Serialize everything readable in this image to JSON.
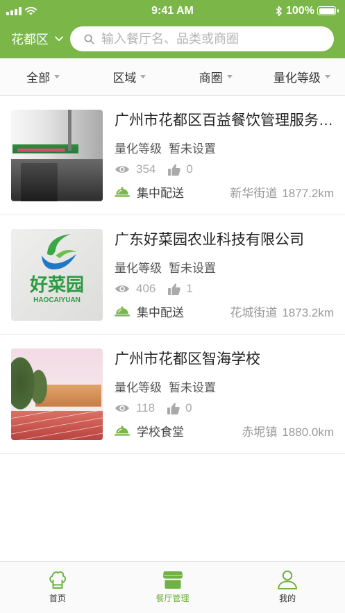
{
  "status_bar": {
    "time": "9:41 AM",
    "battery_percent": "100%",
    "icons": [
      "signal-icon",
      "wifi-icon",
      "bluetooth-icon",
      "battery-icon"
    ]
  },
  "header": {
    "city": "花都区",
    "city_icon": "chevron-down-icon",
    "search_placeholder": "输入餐厅名、品类或商圈",
    "search_icon": "search-icon"
  },
  "filters": [
    {
      "label": "全部",
      "icon": "triangle-down-icon"
    },
    {
      "label": "区域",
      "icon": "triangle-down-icon"
    },
    {
      "label": "商圈",
      "icon": "triangle-down-icon"
    },
    {
      "label": "量化等级",
      "icon": "triangle-down-icon"
    }
  ],
  "list_icons": {
    "views": "eye-icon",
    "likes": "thumbs-up-icon",
    "category": "cloche-icon"
  },
  "restaurants": [
    {
      "name": "广州市花都区百益餐饮管理服务…",
      "grade_label": "量化等级",
      "grade_value": "暂未设置",
      "views": "354",
      "likes": "0",
      "category": "集中配送",
      "street": "新华街道",
      "distance": "1877.2km"
    },
    {
      "name": "广东好菜园农业科技有限公司",
      "grade_label": "量化等级",
      "grade_value": "暂未设置",
      "views": "406",
      "likes": "1",
      "category": "集中配送",
      "street": "花城街道",
      "distance": "1873.2km",
      "logo_text": "好菜园",
      "logo_subtext": "HAOCAIYUAN"
    },
    {
      "name": "广州市花都区智海学校",
      "grade_label": "量化等级",
      "grade_value": "暂未设置",
      "views": "118",
      "likes": "0",
      "category": "学校食堂",
      "street": "赤坭镇",
      "distance": "1880.0km"
    }
  ],
  "tabs": [
    {
      "label": "首页",
      "icon": "chef-hat-icon",
      "active": false
    },
    {
      "label": "餐厅管理",
      "icon": "storefront-icon",
      "active": true
    },
    {
      "label": "我的",
      "icon": "person-icon",
      "active": false
    }
  ],
  "colors": {
    "brand": "#7ab648",
    "tab_active": "#6fb142",
    "text": "#333333",
    "secondary_text": "#555555",
    "muted_text": "#999999",
    "divider": "#ececec"
  }
}
